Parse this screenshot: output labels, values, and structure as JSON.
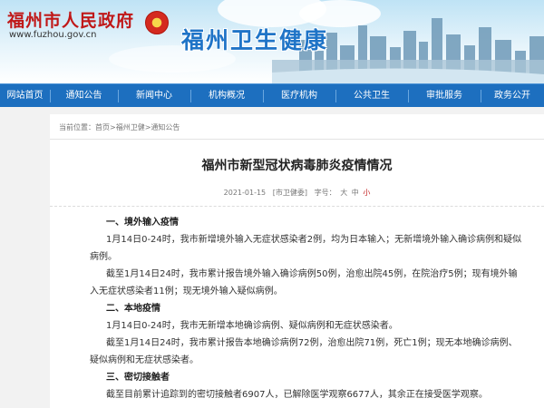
{
  "header": {
    "gov_title": "福州市人民政府",
    "gov_url": "www.fuzhou.gov.cn",
    "site_title": "福州卫生健康"
  },
  "nav": {
    "items": [
      {
        "label": "网站首页"
      },
      {
        "label": "通知公告"
      },
      {
        "label": "新闻中心"
      },
      {
        "label": "机构概况"
      },
      {
        "label": "医疗机构"
      },
      {
        "label": "公共卫生"
      },
      {
        "label": "审批服务"
      },
      {
        "label": "政务公开"
      }
    ]
  },
  "breadcrumb": {
    "prefix": "当前位置：",
    "items": [
      "首页",
      "福州卫健",
      "通知公告"
    ],
    "separator": ">"
  },
  "article": {
    "title": "福州市新型冠状病毒肺炎疫情情况",
    "date": "2021-01-15",
    "source": "[市卫健委]",
    "font_label": "字号：",
    "sizes": [
      "大",
      "中",
      "小"
    ],
    "sections": [
      {
        "heading": "一、境外输入疫情",
        "paragraphs": [
          "1月14日0-24时，我市新增境外输入无症状感染者2例，均为日本输入；无新增境外输入确诊病例和疑似病例。",
          "截至1月14日24时，我市累计报告境外输入确诊病例50例，治愈出院45例，在院治疗5例；现有境外输入无症状感染者11例；现无境外输入疑似病例。"
        ]
      },
      {
        "heading": "二、本地疫情",
        "paragraphs": [
          "1月14日0-24时，我市无新增本地确诊病例、疑似病例和无症状感染者。",
          "截至1月14日24时，我市累计报告本地确诊病例72例，治愈出院71例，死亡1例；现无本地确诊病例、疑似病例和无症状感染者。"
        ]
      },
      {
        "heading": "三、密切接触者",
        "paragraphs": [
          "截至目前累计追踪到的密切接触者6907人，已解除医学观察6677人，其余正在接受医学观察。"
        ]
      }
    ]
  },
  "colors": {
    "nav_bg": "#1d6fbf",
    "gov_red": "#c01818",
    "site_blue": "#1f74c7"
  }
}
